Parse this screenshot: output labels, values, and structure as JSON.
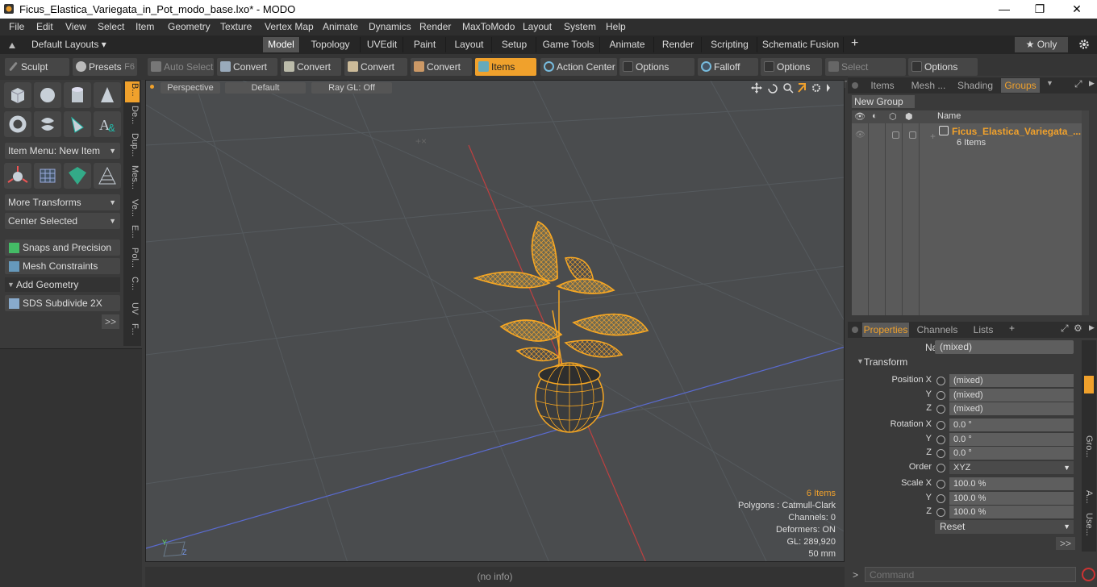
{
  "window": {
    "title": "Ficus_Elastica_Variegata_in_Pot_modo_base.lxo* - MODO",
    "minimize": "—",
    "restore": "❐",
    "close": "✕"
  },
  "menu": [
    "File",
    "Edit",
    "View",
    "Select",
    "Item",
    "Geometry",
    "Texture",
    "Vertex Map",
    "Animate",
    "Dynamics",
    "Render",
    "MaxToModo",
    "Layout",
    "System",
    "Help"
  ],
  "layouts": {
    "default_label": "Default Layouts ▾",
    "tabs": [
      "Model",
      "Topology",
      "UVEdit",
      "Paint",
      "Layout",
      "Setup",
      "Game Tools",
      "Animate",
      "Render",
      "Scripting",
      "Schematic Fusion"
    ],
    "plus": "+",
    "only_label": "★ Only"
  },
  "toolbar": {
    "sculpt": "Sculpt",
    "presets": "Presets",
    "presets_key": "F6",
    "auto_select": "Auto Select",
    "convert1": "Convert",
    "convert2": "Convert",
    "convert3": "Convert",
    "convert4": "Convert",
    "items": "Items",
    "action_center": "Action Center",
    "options1": "Options",
    "falloff": "Falloff",
    "options2": "Options",
    "select_through": "Select Through",
    "options3": "Options"
  },
  "left": {
    "item_menu": "Item Menu: New Item",
    "more_transforms": "More Transforms",
    "center_selected": "Center Selected",
    "snaps": "Snaps and Precision",
    "mesh_constraints": "Mesh Constraints",
    "add_geometry": "Add Geometry",
    "sds": "SDS Subdivide 2X",
    "more": ">>",
    "vtabs": [
      "B...",
      "De...",
      "Dup...",
      "Mes...",
      "Ve...",
      "E...",
      "Pol...",
      "C...",
      "UV",
      "F..."
    ]
  },
  "viewport": {
    "perspective": "Perspective",
    "default": "Default",
    "raygl": "Ray GL: Off",
    "hud": {
      "items": "6 Items",
      "polygons": "Polygons : Catmull-Clark",
      "channels": "Channels: 0",
      "deformers": "Deformers: ON",
      "gl": "GL: 289,920",
      "scale": "50 mm"
    },
    "status": "(no info)"
  },
  "groups": {
    "tabs": [
      "Items",
      "Mesh ...",
      "Shading",
      "Groups"
    ],
    "new_group": "New Group",
    "col_name": "Name",
    "row_name": "Ficus_Elastica_Variegata_...",
    "row_sub": "6 Items"
  },
  "properties": {
    "tabs": [
      "Properties",
      "Channels",
      "Lists"
    ],
    "plus": "+",
    "name_label": "Name",
    "name_value": "(mixed)",
    "transform": "Transform",
    "position_x_label": "Position X",
    "y_label": "Y",
    "z_label": "Z",
    "pos_x": "(mixed)",
    "pos_y": "(mixed)",
    "pos_z": "(mixed)",
    "rotation_x_label": "Rotation X",
    "rot_x": "0.0 °",
    "rot_y": "0.0 °",
    "rot_z": "0.0 °",
    "order_label": "Order",
    "order_value": "XYZ",
    "scale_x_label": "Scale X",
    "scl_x": "100.0 %",
    "scl_y": "100.0 %",
    "scl_z": "100.0 %",
    "reset": "Reset",
    "more": ">>",
    "side_tabs": [
      "Gro...",
      "A...",
      "Use..."
    ]
  },
  "command": {
    "prompt": ">",
    "placeholder": "Command"
  },
  "colors": {
    "accent": "#f0a12c",
    "panel": "#3a3a3a",
    "viewport": "#4a4c4e"
  }
}
